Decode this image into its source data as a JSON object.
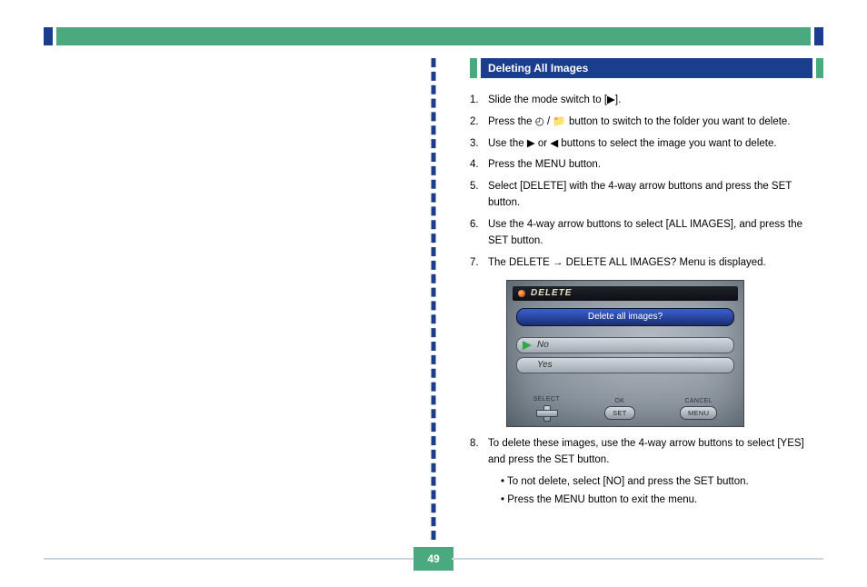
{
  "page_number": "49",
  "right_column": {
    "header": "Deleting All Images",
    "steps": [
      {
        "n": "1.",
        "text": "Slide the mode switch to [&#9654;]."
      },
      {
        "n": "2.",
        "text": "Press the <span class='inline-icon'>&#9716;</span> / <span class='inline-icon'>&#128193;</span> button to switch to the folder you want to delete."
      },
      {
        "n": "3.",
        "text": "Use the <span class='inline-icon'>&#9654;</span> or <span class='inline-icon'>&#9664;</span> buttons to select the image you want to delete."
      },
      {
        "n": "4.",
        "text": "Press the MENU button."
      },
      {
        "n": "5.",
        "text": "Select [DELETE] with the 4-way arrow buttons and press the SET button."
      },
      {
        "n": "6.",
        "text": "Use the 4-way arrow buttons to select [ALL IMAGES], and press the SET button."
      },
      {
        "n": "7.",
        "text": "The DELETE &rarr; DELETE ALL IMAGES? Menu is displayed."
      }
    ],
    "after_dialog": [
      {
        "n": "8.",
        "text": "To delete these images, use the 4-way arrow buttons to select [YES] and press the SET button.",
        "notes": [
          "To not delete, select [NO] and press the SET button.",
          "Press the MENU button to exit the menu."
        ]
      }
    ]
  },
  "dialog": {
    "title": "DELETE",
    "question": "Delete all images?",
    "options": [
      "No",
      "Yes"
    ],
    "footer": {
      "select": "SELECT",
      "ok_label": "OK",
      "ok_btn": "SET",
      "cancel_label": "CANCEL",
      "cancel_btn": "MENU"
    }
  }
}
